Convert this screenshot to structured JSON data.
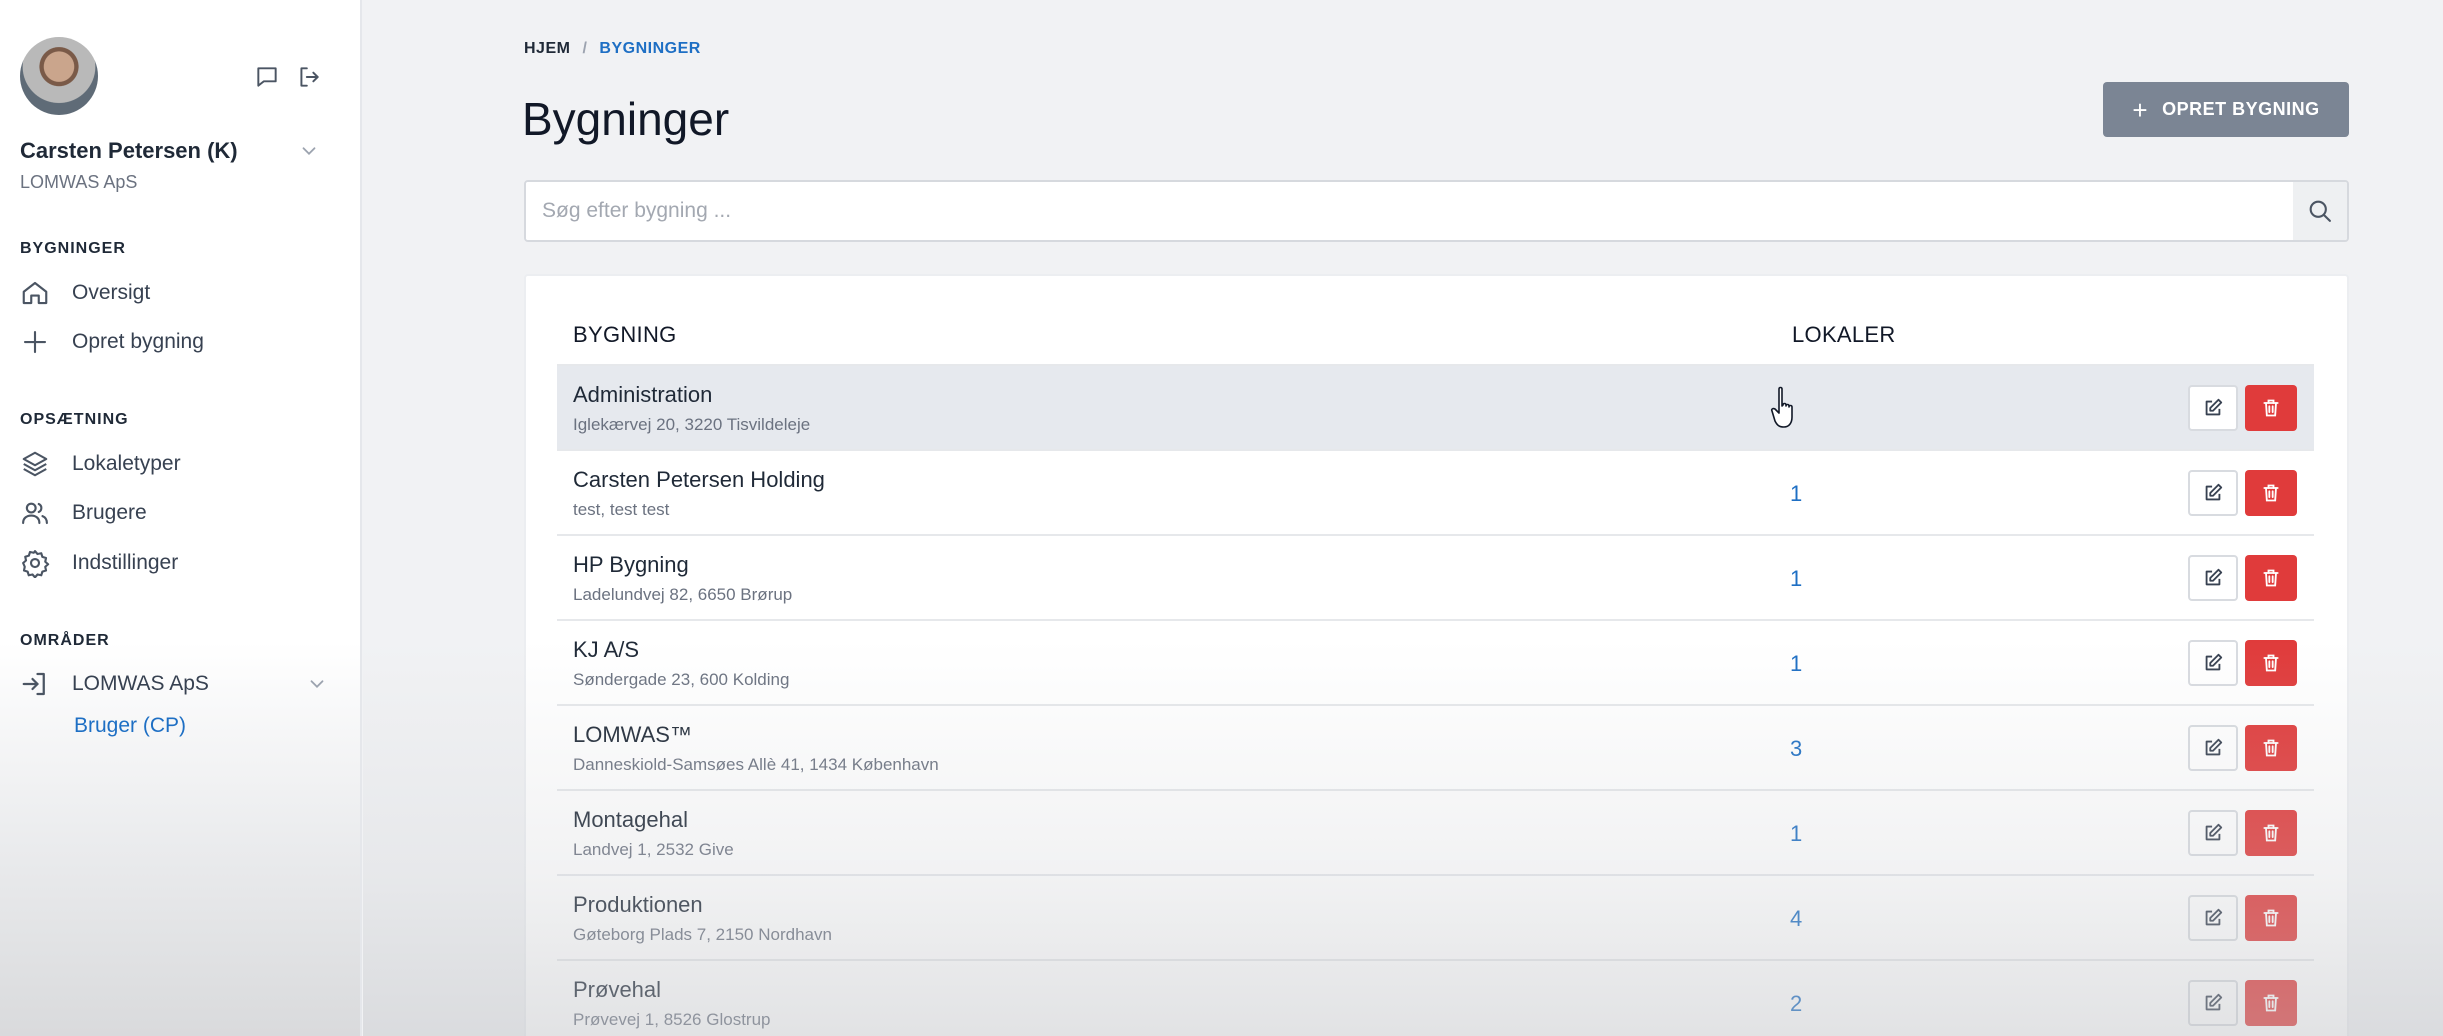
{
  "user": {
    "name": "Carsten Petersen (K)",
    "company": "LOMWAS ApS"
  },
  "sidebar": {
    "section_buildings": "BYGNINGER",
    "overview": "Oversigt",
    "create_building": "Opret bygning",
    "section_setup": "OPSÆTNING",
    "room_types": "Lokaletyper",
    "users": "Brugere",
    "settings": "Indstillinger",
    "section_areas": "OMRÅDER",
    "area_company": "LOMWAS ApS",
    "area_user": "Bruger (CP)"
  },
  "breadcrumb": {
    "home": "HJEM",
    "sep": "/",
    "current": "BYGNINGER"
  },
  "page_title": "Bygninger",
  "create_button": {
    "plus": "+",
    "label": "OPRET BYGNING"
  },
  "search": {
    "placeholder": "Søg efter bygning ..."
  },
  "table": {
    "col_building": "BYGNING",
    "col_rooms": "LOKALER",
    "rows": [
      {
        "name": "Administration",
        "address": "Iglekærvej 20, 3220 Tisvildeleje",
        "rooms": ""
      },
      {
        "name": "Carsten Petersen Holding",
        "address": "test, test test",
        "rooms": "1"
      },
      {
        "name": "HP Bygning",
        "address": "Ladelundvej 82, 6650 Brørup",
        "rooms": "1"
      },
      {
        "name": "KJ A/S",
        "address": "Søndergade 23, 600 Kolding",
        "rooms": "1"
      },
      {
        "name": "LOMWAS™",
        "address": "Danneskiold-Samsøes Allè 41, 1434 København",
        "rooms": "3"
      },
      {
        "name": "Montagehal",
        "address": "Landvej 1, 2532 Give",
        "rooms": "1"
      },
      {
        "name": "Produktionen",
        "address": "Gøteborg Plads 7, 2150 Nordhavn",
        "rooms": "4"
      },
      {
        "name": "Prøvehal",
        "address": "Prøvevej 1, 8526 Glostrup",
        "rooms": "2"
      }
    ]
  },
  "colors": {
    "accent": "#1e6fc4",
    "delete": "#e03b3b",
    "create_button": "#7b8594",
    "row_hover": "#e6e9ee"
  }
}
